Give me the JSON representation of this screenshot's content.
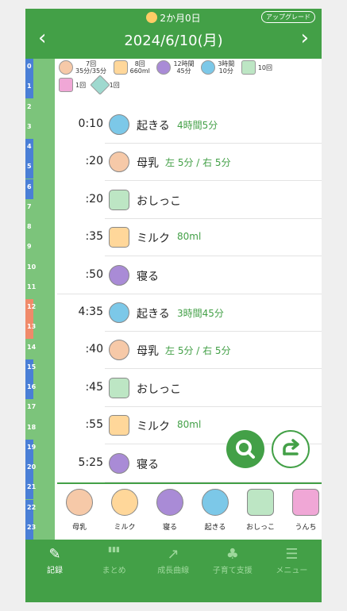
{
  "header": {
    "age": "2か月0日",
    "upgrade": "アップグレード",
    "date": "2024/6/10(月)",
    "prev_icon": "chevron-left-icon",
    "next_icon": "chevron-right-icon"
  },
  "rail_hours": [
    "0",
    "1",
    "2",
    "3",
    "4",
    "5",
    "6",
    "7",
    "8",
    "9",
    "10",
    "11",
    "12",
    "13",
    "14",
    "15",
    "16",
    "17",
    "18",
    "19",
    "20",
    "21",
    "22",
    "23"
  ],
  "summary": {
    "nurse": {
      "count": "7回",
      "detail": "35分/35分"
    },
    "milk": {
      "count": "8回",
      "detail": "660ml"
    },
    "sleep": {
      "count": "12時間",
      "detail": "45分"
    },
    "wake": {
      "count": "3時間",
      "detail": "10分"
    },
    "pee": {
      "count": "10回"
    },
    "poo": {
      "count": "1回"
    },
    "bath": {
      "count": "1回"
    }
  },
  "events": [
    {
      "time": "0:10",
      "label": "起きる",
      "extra": "4時間5分",
      "icon": "wake-icon"
    },
    {
      "time": ":20",
      "label": "母乳",
      "extra": "左 5分 / 右 5分",
      "icon": "nursing-icon"
    },
    {
      "time": ":20",
      "label": "おしっこ",
      "extra": "",
      "icon": "pee-icon"
    },
    {
      "time": ":35",
      "label": "ミルク",
      "extra": "80ml",
      "icon": "milk-bottle-icon"
    },
    {
      "time": ":50",
      "label": "寝る",
      "extra": "",
      "icon": "sleep-icon"
    },
    {
      "time": "4:35",
      "label": "起きる",
      "extra": "3時間45分",
      "icon": "wake-icon"
    },
    {
      "time": ":40",
      "label": "母乳",
      "extra": "左 5分 / 右 5分",
      "icon": "nursing-icon"
    },
    {
      "time": ":45",
      "label": "おしっこ",
      "extra": "",
      "icon": "pee-icon"
    },
    {
      "time": ":55",
      "label": "ミルク",
      "extra": "80ml",
      "icon": "milk-bottle-icon"
    },
    {
      "time": "5:25",
      "label": "寝る",
      "extra": "",
      "icon": "sleep-icon"
    }
  ],
  "quick_add": [
    "母乳",
    "ミルク",
    "寝る",
    "起きる",
    "おしっこ",
    "うんち"
  ],
  "bottom_nav": [
    {
      "label": "記録",
      "icon": "pencil-icon"
    },
    {
      "label": "まとめ",
      "icon": "bar-chart-icon"
    },
    {
      "label": "成長曲線",
      "icon": "trend-up-icon"
    },
    {
      "label": "子育て支援",
      "icon": "sprout-icon"
    },
    {
      "label": "メニュー",
      "icon": "menu-icon"
    }
  ],
  "colors": {
    "primary": "#43a047",
    "accent_text": "#43a047",
    "rail": "#7cc47b",
    "sleep_bar": "#4a7fd6",
    "wake_bar": "#f08a6a"
  }
}
